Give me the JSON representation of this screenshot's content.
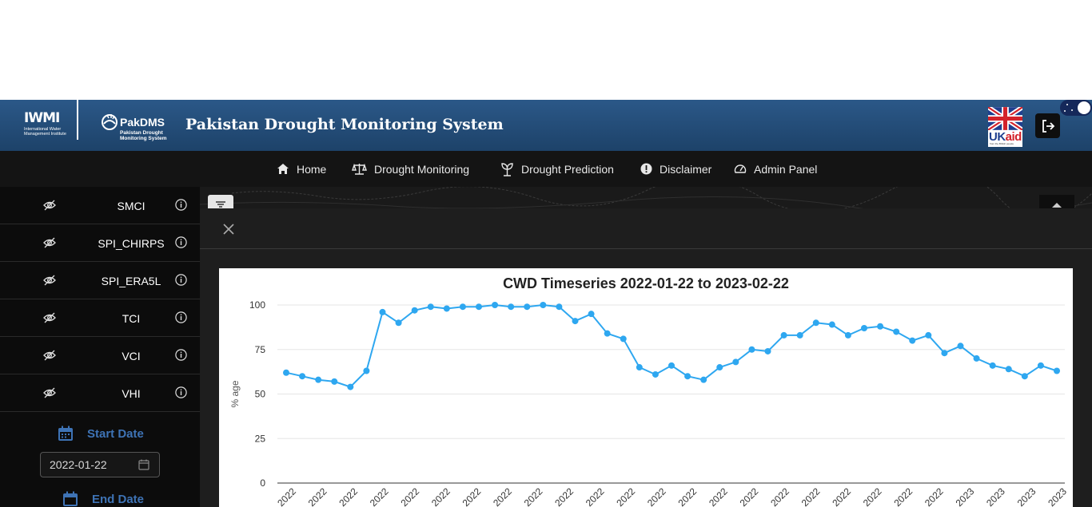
{
  "header": {
    "iwmi_logo_big": "IWMI",
    "iwmi_logo_small": "International Water Management Institute",
    "pakdms_logo_name": "PakDMS",
    "pakdms_logo_sub": "Pakistan Drought Monitoring System",
    "app_title": "Pakistan Drought Monitoring System",
    "ukaid_uk": "UK",
    "ukaid_aid": "aid",
    "ukaid_tagline": "from the British people"
  },
  "nav": {
    "items": [
      {
        "label": "Home",
        "icon": "home-icon"
      },
      {
        "label": "Drought Monitoring",
        "icon": "balance-scale-icon"
      },
      {
        "label": "Drought Prediction",
        "icon": "seedling-icon"
      },
      {
        "label": "Disclaimer",
        "icon": "exclamation-circle-icon"
      },
      {
        "label": "Admin Panel",
        "icon": "dashboard-gauge-icon"
      }
    ]
  },
  "sidebar": {
    "layers": [
      {
        "label": "SMCI"
      },
      {
        "label": "SPI_CHIRPS"
      },
      {
        "label": "SPI_ERA5L"
      },
      {
        "label": "TCI"
      },
      {
        "label": "VCI"
      },
      {
        "label": "VHI"
      }
    ],
    "start_date_label": "Start Date",
    "start_date_value": "2022-01-22",
    "end_date_label": "End Date"
  },
  "chart_data": {
    "type": "line",
    "title": "CWD Timeseries 2022-01-22 to 2023-02-22",
    "ylabel": "% age",
    "xlabel": "",
    "ylim": [
      0,
      100
    ],
    "yticks": [
      0,
      25,
      50,
      75,
      100
    ],
    "grid": true,
    "color": "#2ea7f0",
    "xtick_labels": [
      "2022",
      "2022",
      "2022",
      "2022",
      "2022",
      "2022",
      "2022",
      "2022",
      "2022",
      "2022",
      "2022",
      "2022",
      "2022",
      "2022",
      "2022",
      "2022",
      "2022",
      "2022",
      "2022",
      "2022",
      "2022",
      "2022",
      "2023",
      "2023",
      "2023",
      "2023"
    ],
    "values": [
      62,
      60,
      58,
      57,
      54,
      63,
      96,
      90,
      97,
      99,
      98,
      99,
      99,
      100,
      99,
      99,
      100,
      99,
      91,
      95,
      84,
      81,
      65,
      61,
      66,
      60,
      58,
      65,
      68,
      75,
      74,
      83,
      83,
      90,
      89,
      83,
      87,
      88,
      85,
      80,
      83,
      73,
      77,
      70,
      66,
      64,
      60,
      66,
      63
    ]
  },
  "colors": {
    "header_bg": "#24507d",
    "app_bg": "#0c0c0c",
    "accent": "#3e73b5",
    "line": "#2ea7f0"
  }
}
